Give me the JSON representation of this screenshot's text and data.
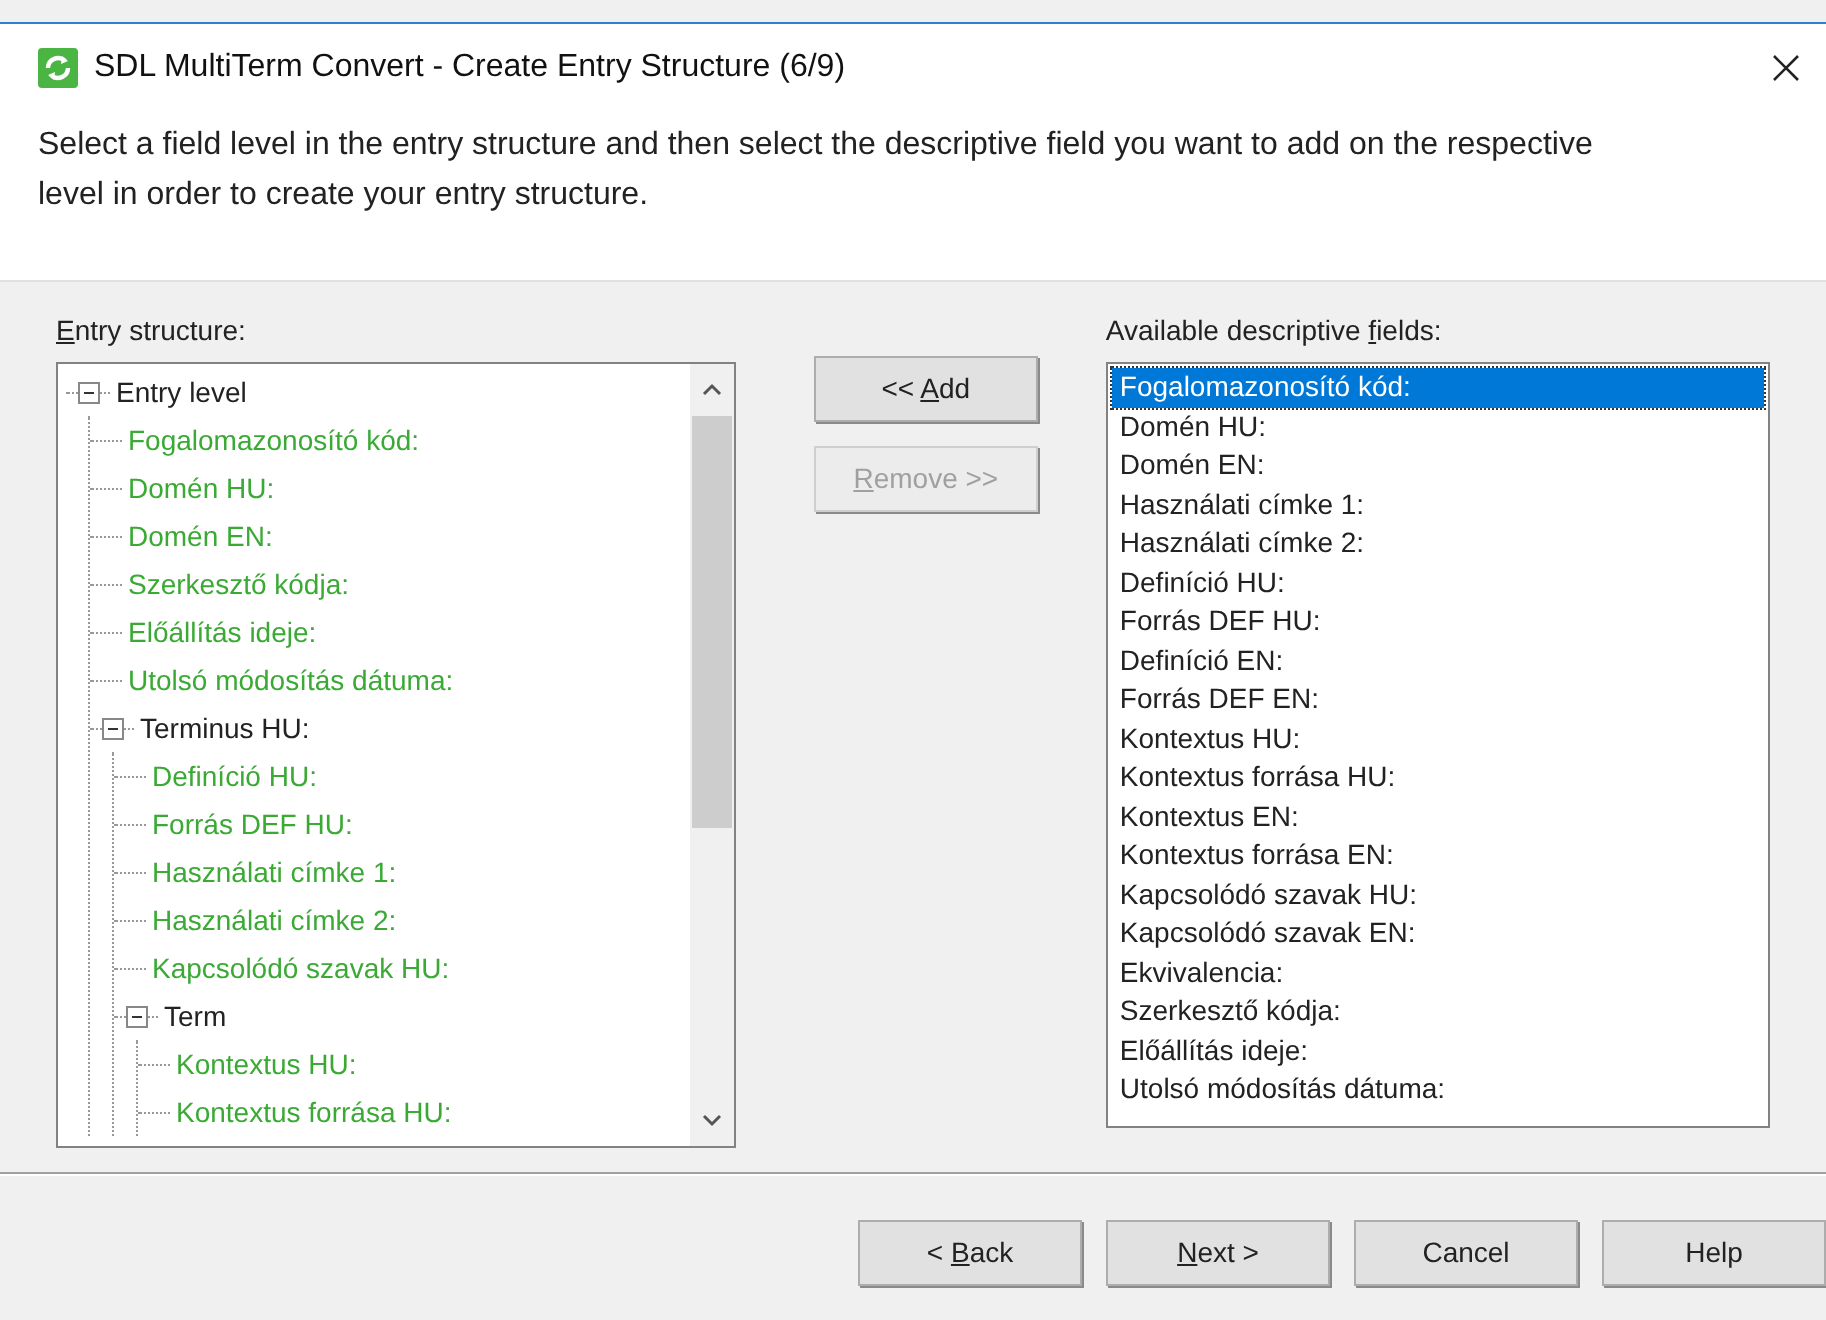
{
  "window": {
    "title": "SDL MultiTerm Convert - Create Entry Structure (6/9)"
  },
  "instructions": "Select a field level in the entry structure and then select the descriptive field you want to add on the respective level in order to create your entry structure.",
  "entry_structure": {
    "label_parts": {
      "key": "E",
      "after": "ntry structure:"
    },
    "tree": [
      {
        "label": "Entry level",
        "kind": "level",
        "expanded": true,
        "children": [
          {
            "label": "Fogalomazonosító kód:",
            "kind": "field"
          },
          {
            "label": "Domén HU:",
            "kind": "field"
          },
          {
            "label": "Domén EN:",
            "kind": "field"
          },
          {
            "label": "Szerkesztő kódja:",
            "kind": "field"
          },
          {
            "label": "Előállítás ideje:",
            "kind": "field"
          },
          {
            "label": "Utolsó módosítás dátuma:",
            "kind": "field"
          },
          {
            "label": "Terminus HU:",
            "kind": "level",
            "expanded": true,
            "children": [
              {
                "label": "Definíció HU:",
                "kind": "field"
              },
              {
                "label": "Forrás DEF HU:",
                "kind": "field"
              },
              {
                "label": "Használati címke 1:",
                "kind": "field"
              },
              {
                "label": "Használati címke 2:",
                "kind": "field"
              },
              {
                "label": "Kapcsolódó szavak HU:",
                "kind": "field"
              },
              {
                "label": "Term",
                "kind": "level",
                "expanded": true,
                "children": [
                  {
                    "label": "Kontextus HU:",
                    "kind": "field"
                  },
                  {
                    "label": "Kontextus forrása HU:",
                    "kind": "field"
                  }
                ]
              }
            ]
          }
        ]
      }
    ]
  },
  "middle_buttons": [
    {
      "label_parts": {
        "before": "<< ",
        "key": "A",
        "after": "dd"
      },
      "disabled": false
    },
    {
      "label_parts": {
        "key": "R",
        "after": "emove >>"
      },
      "disabled": true
    }
  ],
  "available_fields": {
    "label_parts": {
      "before": "Available descriptive ",
      "key": "f",
      "after": "ields:"
    },
    "items": [
      {
        "label": "Fogalomazonosító kód:",
        "selected": true
      },
      {
        "label": "Domén HU:",
        "selected": false
      },
      {
        "label": "Domén EN:",
        "selected": false
      },
      {
        "label": "Használati címke 1:",
        "selected": false
      },
      {
        "label": "Használati címke 2:",
        "selected": false
      },
      {
        "label": "Definíció HU:",
        "selected": false
      },
      {
        "label": "Forrás DEF HU:",
        "selected": false
      },
      {
        "label": "Definíció EN:",
        "selected": false
      },
      {
        "label": "Forrás DEF EN:",
        "selected": false
      },
      {
        "label": "Kontextus HU:",
        "selected": false
      },
      {
        "label": "Kontextus forrása HU:",
        "selected": false
      },
      {
        "label": "Kontextus EN:",
        "selected": false
      },
      {
        "label": "Kontextus forrása EN:",
        "selected": false
      },
      {
        "label": "Kapcsolódó szavak HU:",
        "selected": false
      },
      {
        "label": "Kapcsolódó szavak EN:",
        "selected": false
      },
      {
        "label": "Ekvivalencia:",
        "selected": false
      },
      {
        "label": "Szerkesztő kódja:",
        "selected": false
      },
      {
        "label": "Előállítás ideje:",
        "selected": false
      },
      {
        "label": "Utolsó módosítás dátuma:",
        "selected": false
      }
    ]
  },
  "footer_buttons": [
    {
      "label_parts": {
        "before": "< ",
        "key": "B",
        "after": "ack"
      }
    },
    {
      "label_parts": {
        "key": "N",
        "after": "ext >"
      }
    },
    {
      "label_parts": {
        "before": "Cancel"
      }
    },
    {
      "label_parts": {
        "before": "Help"
      }
    }
  ]
}
